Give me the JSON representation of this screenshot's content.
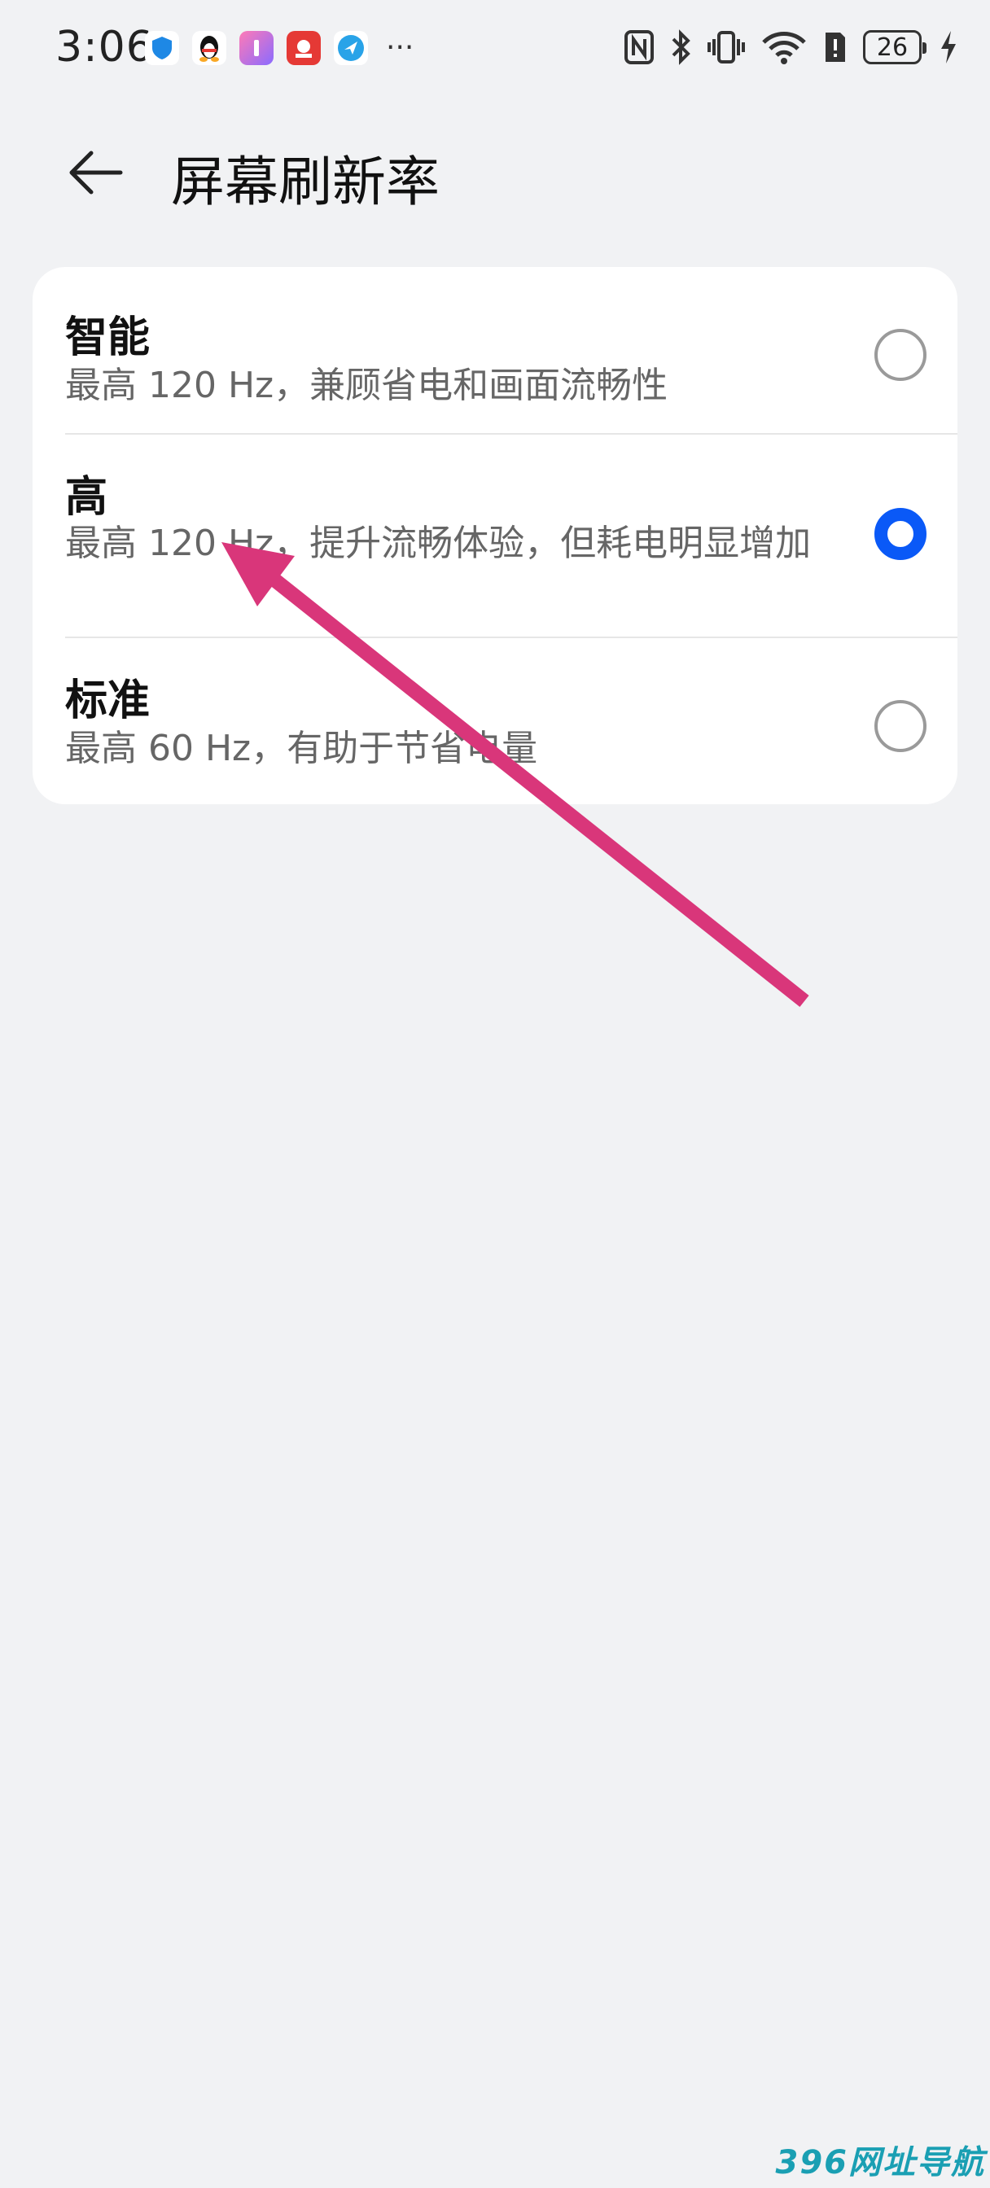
{
  "status_bar": {
    "time": "3:06",
    "notification_icons": [
      "shield-app-icon",
      "qq-penguin-icon",
      "gradient-app-icon",
      "red-app-icon",
      "compass-app-icon"
    ],
    "more": "···",
    "battery_level": "26"
  },
  "header": {
    "title": "屏幕刷新率"
  },
  "options": [
    {
      "title": "智能",
      "desc": "最高 120 Hz，兼顾省电和画面流畅性",
      "selected": false
    },
    {
      "title": "高",
      "desc": "最高 120 Hz，提升流畅体验，但耗电明显增加",
      "selected": true
    },
    {
      "title": "标准",
      "desc": "最高 60 Hz，有助于节省电量",
      "selected": false
    }
  ],
  "colors": {
    "accent": "#0a59f7",
    "annotation_arrow": "#d9367a",
    "background": "#f1f2f4"
  },
  "watermark": "396网址导航"
}
